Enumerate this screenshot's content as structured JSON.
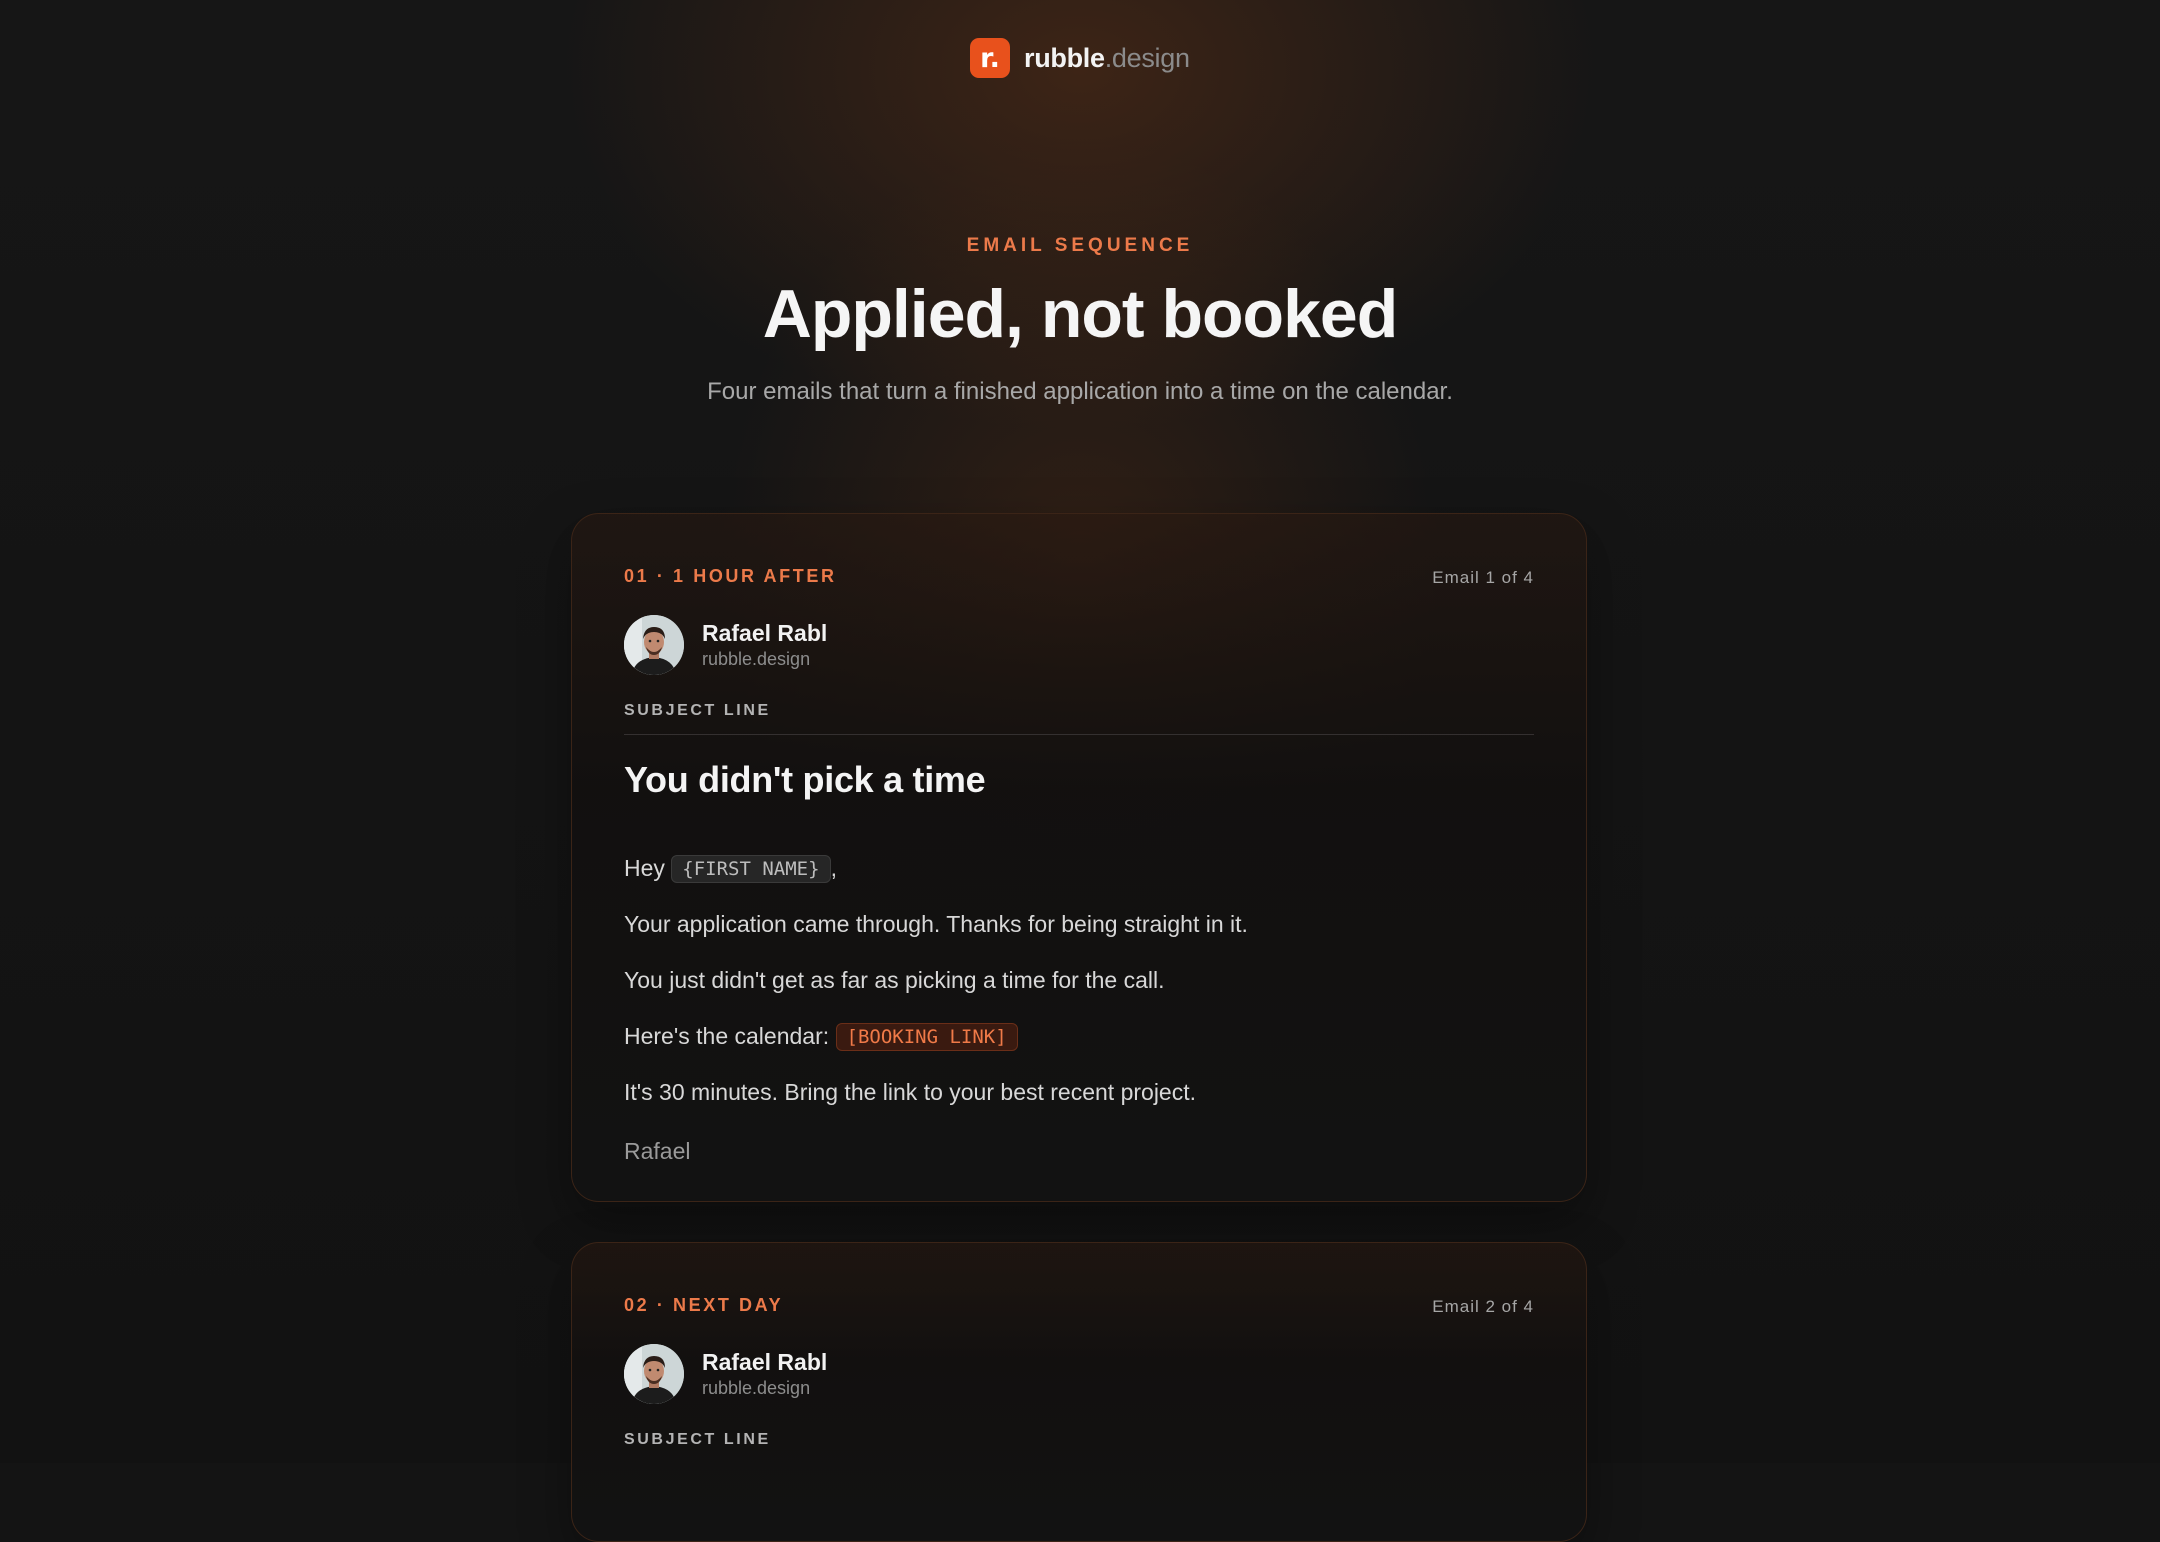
{
  "brand": {
    "logo_letter": "r.",
    "name": "rubble",
    "suffix": ".design",
    "accent": "#e8511c"
  },
  "hero": {
    "eyebrow": "EMAIL SEQUENCE",
    "title": "Applied, not booked",
    "subtitle": "Four emails that turn a finished application into a time on the calendar."
  },
  "emails": [
    {
      "step": "01 · 1 HOUR AFTER",
      "count": "Email 1 of 4",
      "sender_name": "Rafael Rabl",
      "sender_site": "rubble.design",
      "subject_label": "SUBJECT LINE",
      "subject": "You didn't pick a time",
      "greeting": "Hey",
      "first_name_token": "{FIRST NAME}",
      "greeting_end": ",",
      "p1": "Your application came through. Thanks for being straight in it.",
      "p2": "You just didn't get as far as picking a time for the call.",
      "p3": "Here's the calendar:",
      "booking_token": "[BOOKING LINK]",
      "p4": "It's 30 minutes. Bring the link to your best recent project.",
      "signoff": "Rafael"
    },
    {
      "step": "02 · NEXT DAY",
      "count": "Email 2 of 4",
      "sender_name": "Rafael Rabl",
      "sender_site": "rubble.design",
      "subject_label": "SUBJECT LINE"
    }
  ]
}
